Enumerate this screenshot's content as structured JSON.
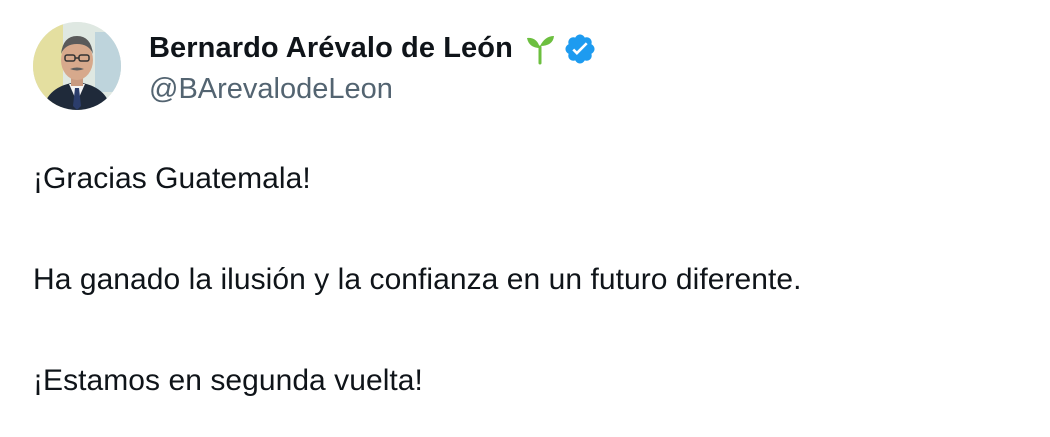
{
  "author": {
    "display_name": "Bernardo Arévalo de León",
    "handle": "@BArevalodeLeon",
    "avatar_icon": "profile-photo",
    "emoji_icon": "sprout-icon",
    "verified_icon": "verified-badge-icon",
    "verified_color": "#1d9bf0",
    "sprout_color": "#6cbf3f"
  },
  "tweet": {
    "lines": [
      "¡Gracias Guatemala!",
      "Ha ganado la ilusión y la confianza en un futuro diferente.",
      "¡Estamos en segunda vuelta!"
    ]
  },
  "colors": {
    "text": "#0f1419",
    "secondary_text": "#536471",
    "background": "#ffffff"
  }
}
